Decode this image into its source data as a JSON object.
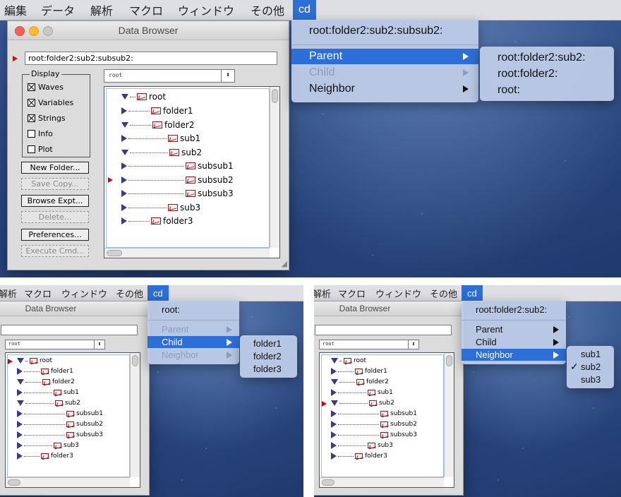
{
  "menubar": {
    "items": [
      "編集",
      "データ",
      "解析",
      "マクロ",
      "ウィンドウ",
      "その他",
      "cd"
    ],
    "items_short": [
      "解析",
      "マクロ",
      "ウィンドウ",
      "その他",
      "cd"
    ]
  },
  "browser": {
    "title": "Data Browser",
    "current_path": "root:folder2:sub2:subsub2:",
    "popup_value": "root",
    "display": {
      "label": "Display",
      "waves": "Waves",
      "variables": "Variables",
      "strings": "Strings",
      "info": "Info",
      "plot": "Plot"
    },
    "buttons": {
      "new_folder": "New Folder...",
      "save_copy": "Save Copy...",
      "browse_expt": "Browse Expt...",
      "delete": "Delete...",
      "preferences": "Preferences...",
      "execute_cmd": "Execute Cmd..."
    },
    "tree": [
      "root",
      "folder1",
      "folder2",
      "sub1",
      "sub2",
      "subsub1",
      "subsub2",
      "subsub3",
      "sub3",
      "folder3"
    ]
  },
  "cd_menu1": {
    "header": "root:folder2:sub2:subsub2:",
    "parent": "Parent",
    "child": "Child",
    "neighbor": "Neighbor",
    "submenu": [
      "root:folder2:sub2:",
      "root:folder2:",
      "root:"
    ]
  },
  "cd_menu2": {
    "header": "root:",
    "parent": "Parent",
    "child": "Child",
    "neighbor": "Neighbor",
    "submenu": [
      "folder1",
      "folder2",
      "folder3"
    ]
  },
  "cd_menu3": {
    "header": "root:folder2:sub2:",
    "parent": "Parent",
    "child": "Child",
    "neighbor": "Neighbor",
    "submenu": [
      "sub1",
      "sub2",
      "sub3"
    ],
    "checkmark": "✓"
  }
}
